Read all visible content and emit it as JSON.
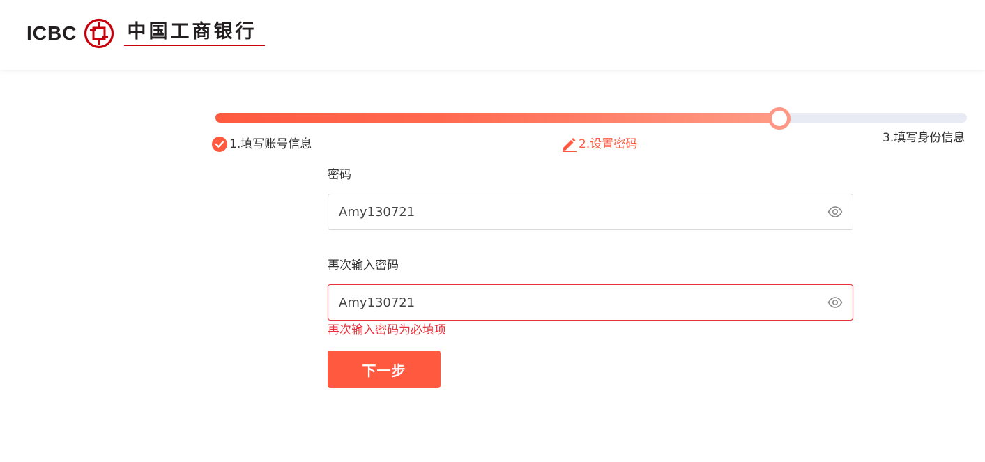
{
  "header": {
    "logo_en": "ICBC",
    "logo_cn": "中国工商银行",
    "brand_color": "#c7000b"
  },
  "stepper": {
    "progress": 0.75,
    "accent_color": "#ff5a40",
    "steps": [
      {
        "label": "1.填写账号信息",
        "status": "done",
        "icon": "check-icon"
      },
      {
        "label": "2.设置密码",
        "status": "current",
        "icon": "pencil-icon"
      },
      {
        "label": "3.填写身份信息",
        "status": "pending"
      }
    ]
  },
  "form": {
    "password": {
      "label": "密码",
      "value": "Amy130721",
      "toggle_icon": "eye-icon"
    },
    "confirm_password": {
      "label": "再次输入密码",
      "value": "Amy130721",
      "toggle_icon": "eye-icon",
      "error": "再次输入密码为必填项"
    },
    "submit_label": "下一步"
  }
}
